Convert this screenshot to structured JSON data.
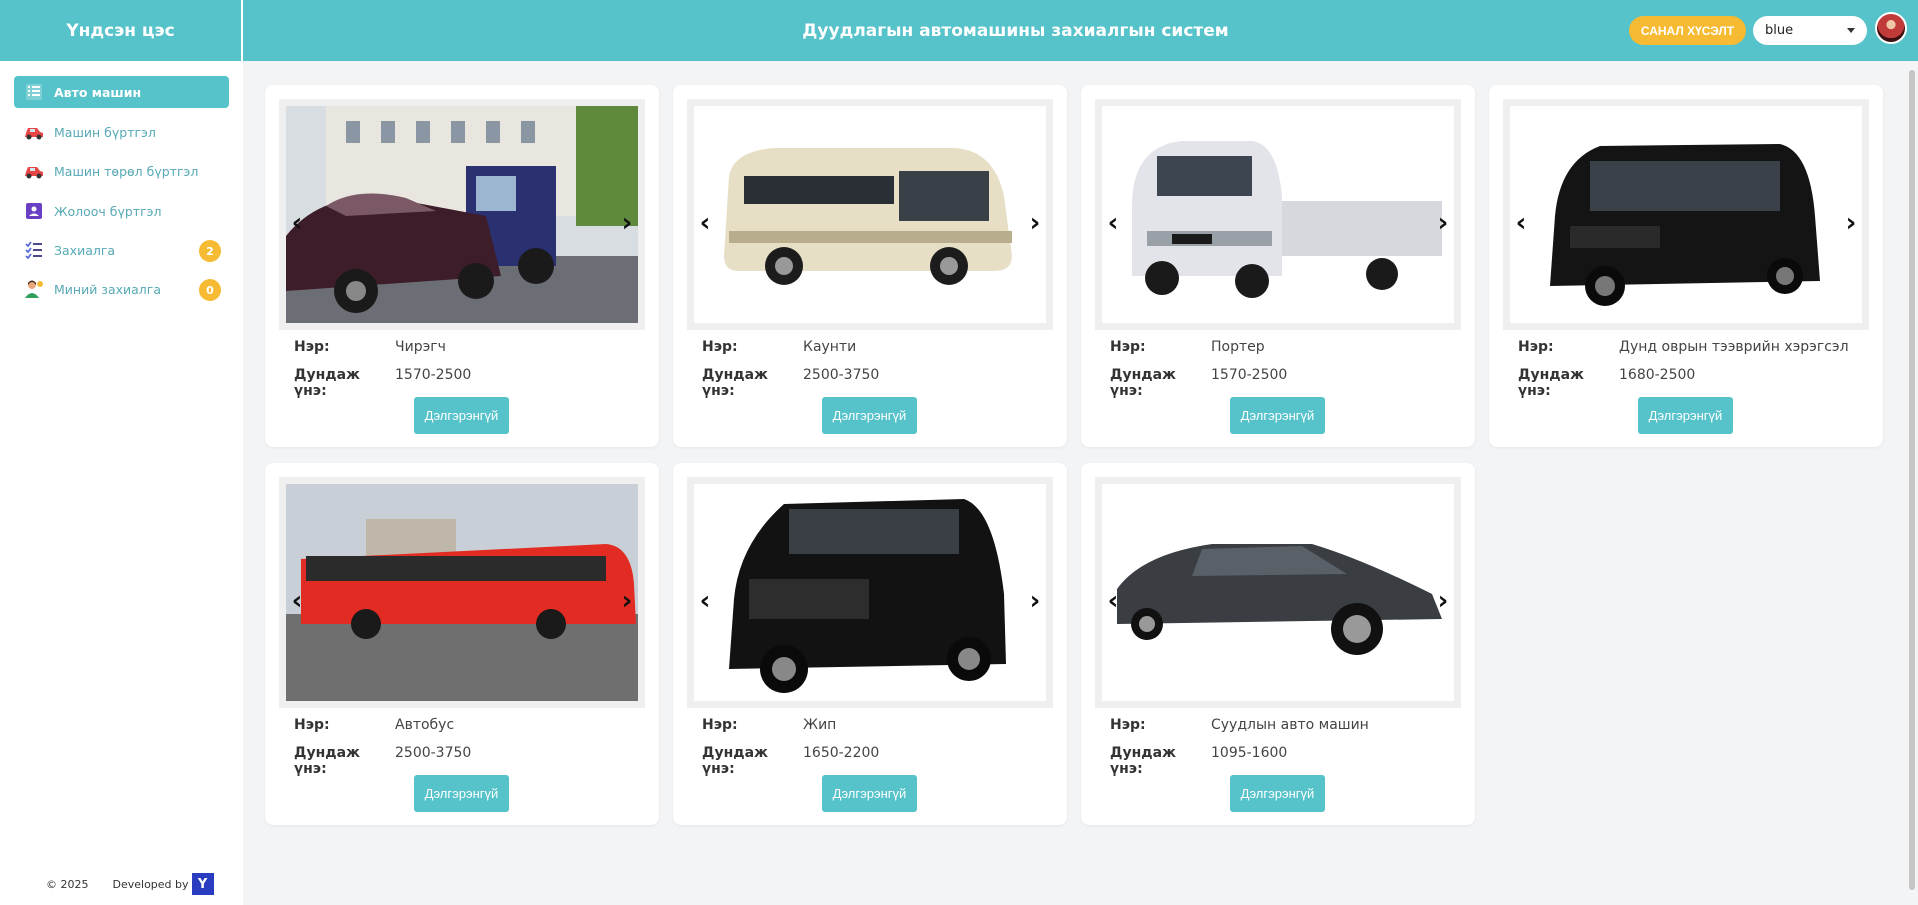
{
  "header": {
    "brand": "Үндсэн цэс",
    "title": "Дуудлагын автомашины захиалгын систем",
    "feedback_label": "САНАЛ ХҮСЭЛТ",
    "theme_value": "blue"
  },
  "sidebar": {
    "items": [
      {
        "label": "Авто машин",
        "icon": "list-icon"
      },
      {
        "label": "Машин бүртгэл",
        "icon": "car-icon"
      },
      {
        "label": "Машин төрөл бүртгэл",
        "icon": "car-icon"
      },
      {
        "label": "Жолооч бүртгэл",
        "icon": "driver-icon"
      },
      {
        "label": "Захиалга",
        "icon": "checklist-icon",
        "badge": "2"
      },
      {
        "label": "Миний захиалга",
        "icon": "person-icon",
        "badge": "0"
      }
    ]
  },
  "footer": {
    "copyright": "© 2025",
    "developed_by": "Developed by",
    "logo_letter": "Y"
  },
  "labels": {
    "name": "Нэр:",
    "price": "Дундаж үнэ:",
    "details": "Дэлгэрэнгүй"
  },
  "cars": [
    {
      "name": "Чирэгч",
      "price": "1570-2500"
    },
    {
      "name": "Каунти",
      "price": "2500-3750"
    },
    {
      "name": "Портер",
      "price": "1570-2500"
    },
    {
      "name": "Дунд оврын тээврийн хэрэгсэл",
      "price": "1680-2500"
    },
    {
      "name": "Автобус",
      "price": "2500-3750"
    },
    {
      "name": "Жип",
      "price": "1650-2200"
    },
    {
      "name": "Суудлын авто машин",
      "price": "1095-1600"
    }
  ],
  "colors": {
    "accent": "#56c2c9",
    "badge": "#f6bb33"
  }
}
